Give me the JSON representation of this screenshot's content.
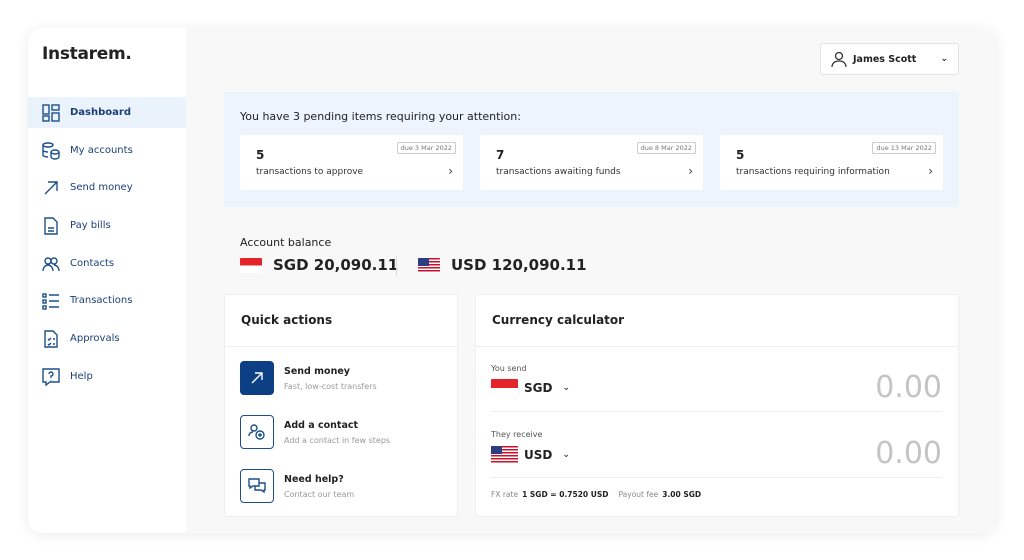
{
  "brand": "Instarem.",
  "sidebar": {
    "items": [
      {
        "label": "Dashboard",
        "icon": "dashboard-icon"
      },
      {
        "label": "My accounts",
        "icon": "coins-icon"
      },
      {
        "label": "Send money",
        "icon": "arrow-up-right-icon"
      },
      {
        "label": "Pay bills",
        "icon": "bill-icon"
      },
      {
        "label": "Contacts",
        "icon": "contacts-icon"
      },
      {
        "label": "Transactions",
        "icon": "list-icon"
      },
      {
        "label": "Approvals",
        "icon": "approvals-icon"
      },
      {
        "label": "Help",
        "icon": "help-icon"
      }
    ]
  },
  "user": {
    "name": "James Scott"
  },
  "pending": {
    "title": "You have 3 pending items requiring your attention:",
    "items": [
      {
        "count": "5",
        "label": "transactions to approve",
        "due": "due 3 Mar 2022"
      },
      {
        "count": "7",
        "label": "transactions awaiting funds",
        "due": "due 8 Mar 2022"
      },
      {
        "count": "5",
        "label": "transactions requiring information",
        "due": "due 13 Mar 2022"
      }
    ]
  },
  "balance": {
    "label": "Account balance",
    "sgd": "SGD 20,090.11",
    "usd": "USD 120,090.11"
  },
  "quick_actions": {
    "title": "Quick actions",
    "items": [
      {
        "title": "Send money",
        "sub": "Fast, low-cost transfers"
      },
      {
        "title": "Add a contact",
        "sub": "Add a contact in few steps"
      },
      {
        "title": "Need help?",
        "sub": "Contact our team"
      }
    ]
  },
  "calculator": {
    "title": "Currency calculator",
    "send_label": "You send",
    "send_currency": "SGD",
    "send_amount": "0.00",
    "receive_label": "They receive",
    "receive_currency": "USD",
    "receive_amount": "0.00",
    "fx_label": "FX rate",
    "fx_value": "1 SGD = 0.7520 USD",
    "fee_label": "Payout fee",
    "fee_value": "3.00 SGD"
  },
  "colors": {
    "accent": "#0d3f85",
    "highlight": "#edf4fd"
  }
}
